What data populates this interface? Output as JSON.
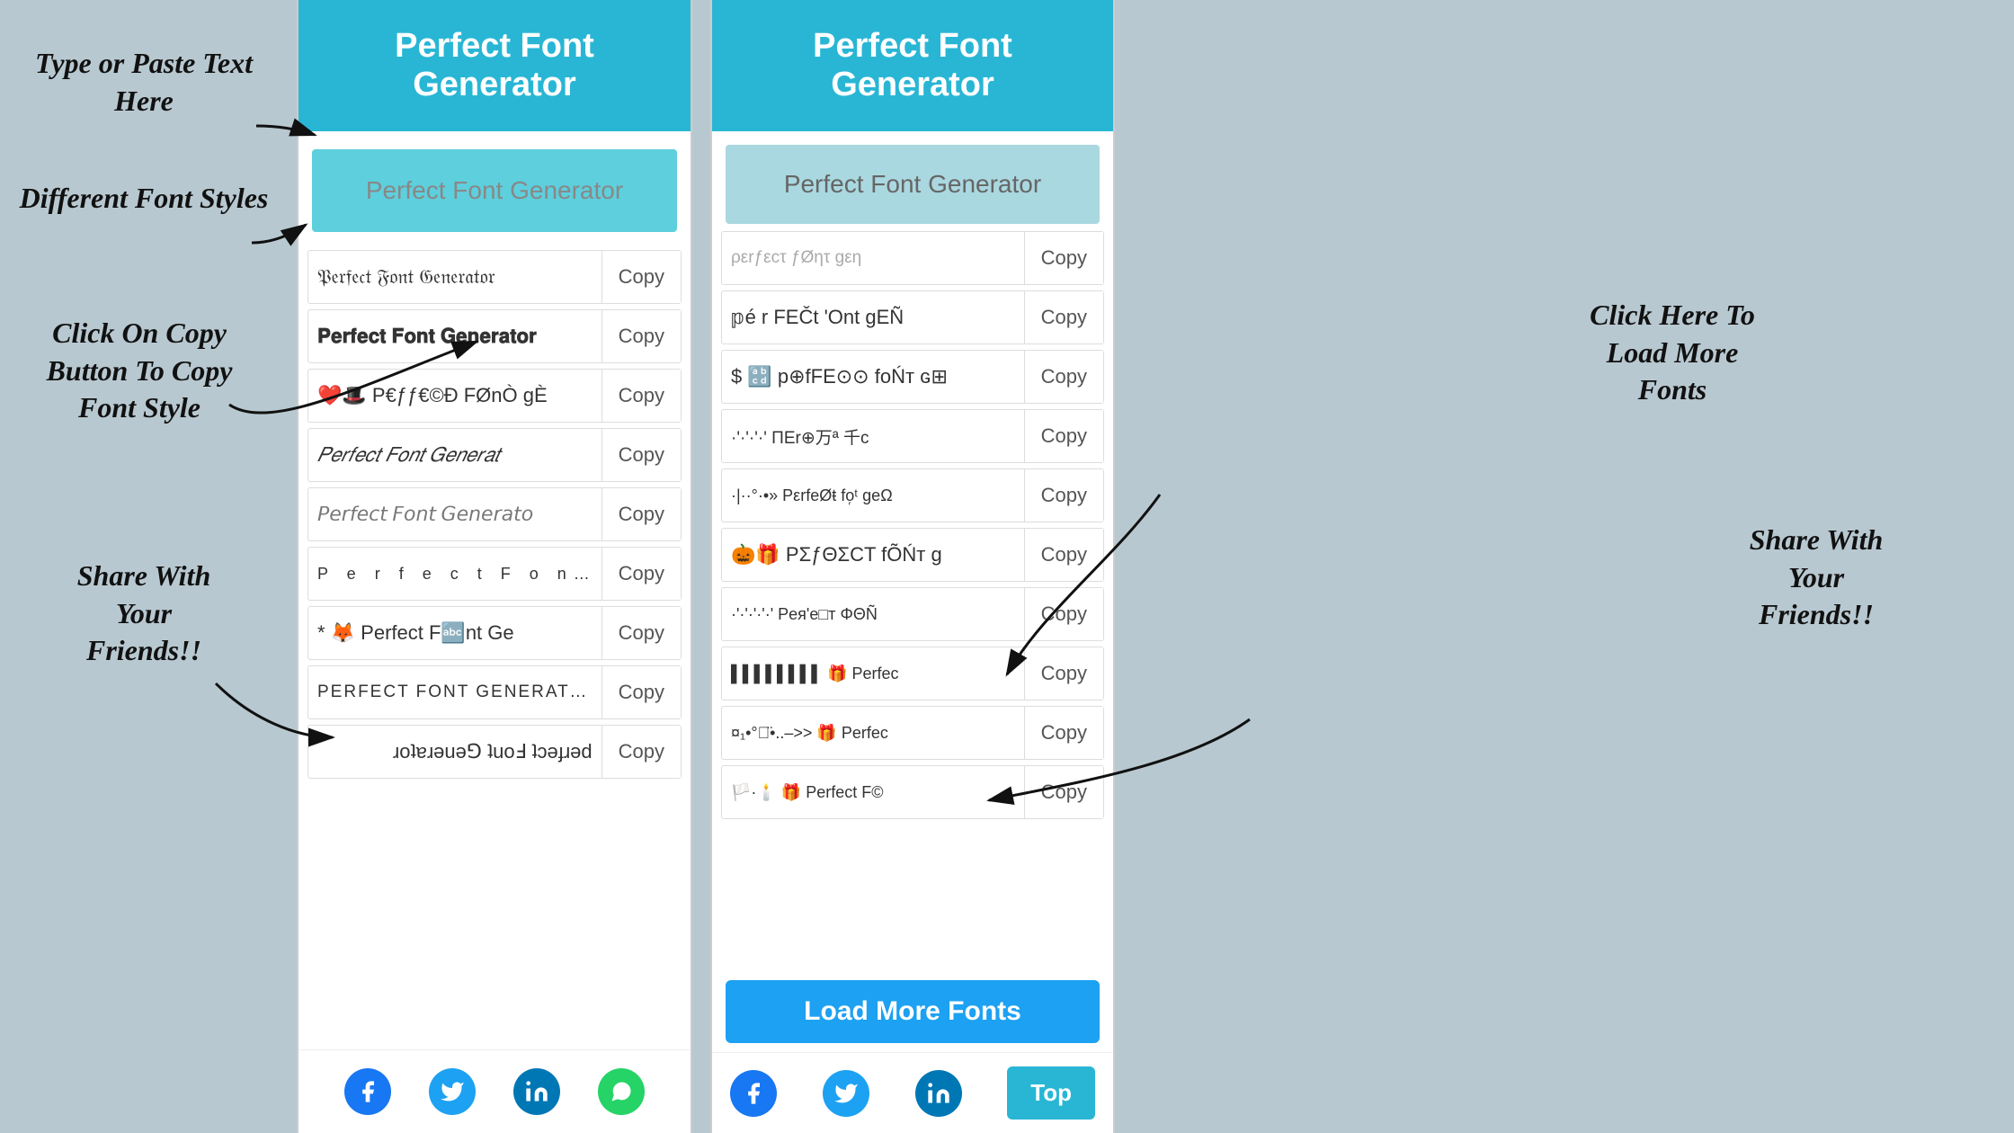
{
  "app": {
    "title": "Perfect Font Generator"
  },
  "annotations": {
    "type_paste": "Type or Paste Text\nHere",
    "different_fonts": "Different Font\nStyles",
    "click_copy": "Click On Copy\nButton To Copy\nFont Style",
    "share_left": "Share With\nYour\nFriends!!",
    "click_load": "Click Here To\nLoad More\nFonts",
    "share_right": "Share With\nYour\nFriends!!"
  },
  "left_panel": {
    "header": "Perfect Font Generator",
    "input_placeholder": "Perfect Font Generator",
    "fonts": [
      {
        "text": "𝔓𝔢𝔯𝔣𝔢𝔠𝔱 𝔉𝔬𝔫𝔱 𝔊𝔢𝔫𝔢𝔯𝔞𝔱𝔬𝔯",
        "copy": "Copy",
        "style": "fraktur"
      },
      {
        "text": "𝐏𝐞𝐫𝐟𝐞𝐜𝐭 𝐅𝐨𝐧𝐭 𝐆𝐞𝐧𝐞𝐫𝐚𝐭𝐨𝐫",
        "copy": "Copy",
        "style": "bold"
      },
      {
        "text": "❤️🎩 P€ƒƒ€©Ð FØnÒ gÈ",
        "copy": "Copy",
        "style": "emoji"
      },
      {
        "text": "𝑃𝑒𝑟𝑓𝑒𝑐𝑡 𝐹𝑜𝑛𝑡 𝐺𝑒𝑛𝑒𝑟𝑎𝑡",
        "copy": "Copy",
        "style": "italic"
      },
      {
        "text": "𝘗𝘦𝘳𝘧𝘦𝘤𝘵 𝘍𝘰𝘯𝘵 𝘎𝘦𝘯𝘦𝘳𝘢𝘵𝘰",
        "copy": "Copy",
        "style": "sans-italic"
      },
      {
        "text": "P e r f e c t  F o n t",
        "copy": "Copy",
        "style": "spaced"
      },
      {
        "text": "* 🦊 Perfect F🔤nt Ge",
        "copy": "Copy",
        "style": "emoji2"
      },
      {
        "text": "PERFECT FONT GENERATOR",
        "copy": "Copy",
        "style": "caps"
      },
      {
        "text": "ɹoʇɐɹǝuǝ⅁ ʇuoℲ ʇɔǝɟɹǝd",
        "copy": "Copy",
        "style": "flip"
      }
    ],
    "social": [
      "facebook",
      "twitter",
      "linkedin",
      "whatsapp"
    ]
  },
  "right_panel": {
    "header": "Perfect Font Generator",
    "input_placeholder": "Perfect Font Generator",
    "fonts": [
      {
        "text": "ρεrƒεcτ ƒØητ gεη",
        "copy": "Copy",
        "style": "partial"
      },
      {
        "text": "𝕡é r FEČt 'Ont gEÑ",
        "copy": "Copy",
        "style": "double"
      },
      {
        "text": "$ 🔡 p⊕fFE⊙⊙ foŃт ɢ⊞",
        "copy": "Copy",
        "style": "emoji3"
      },
      {
        "text": "·'·'·'·'  ΠΕr⊕万ª 千c",
        "copy": "Copy",
        "style": "special"
      },
      {
        "text": "·|··°·•» PεrfeØŧ fo᷊ᵗ geΩ",
        "copy": "Copy",
        "style": "special2"
      },
      {
        "text": "🎃🎁 PΣƒΘΣCT fÕŃт g",
        "copy": "Copy",
        "style": "emoji4"
      },
      {
        "text": "·'·'·'·'·' Pея'e□т ΦΘÑ",
        "copy": "Copy",
        "style": "special3"
      },
      {
        "text": "▌▌▌▌▌▌▌▌ 🎁 Perfec",
        "copy": "Copy",
        "style": "barcode"
      },
      {
        "text": "¤₁•°⌒̈•..–>> 🎁 Perfec",
        "copy": "Copy",
        "style": "special4"
      },
      {
        "text": "🏳️·🕯️ 🎁 Perfect F©",
        "copy": "Copy",
        "style": "emoji5"
      }
    ],
    "load_more": "Load More Fonts",
    "top_btn": "Top",
    "social": [
      "facebook",
      "twitter",
      "linkedin"
    ]
  }
}
